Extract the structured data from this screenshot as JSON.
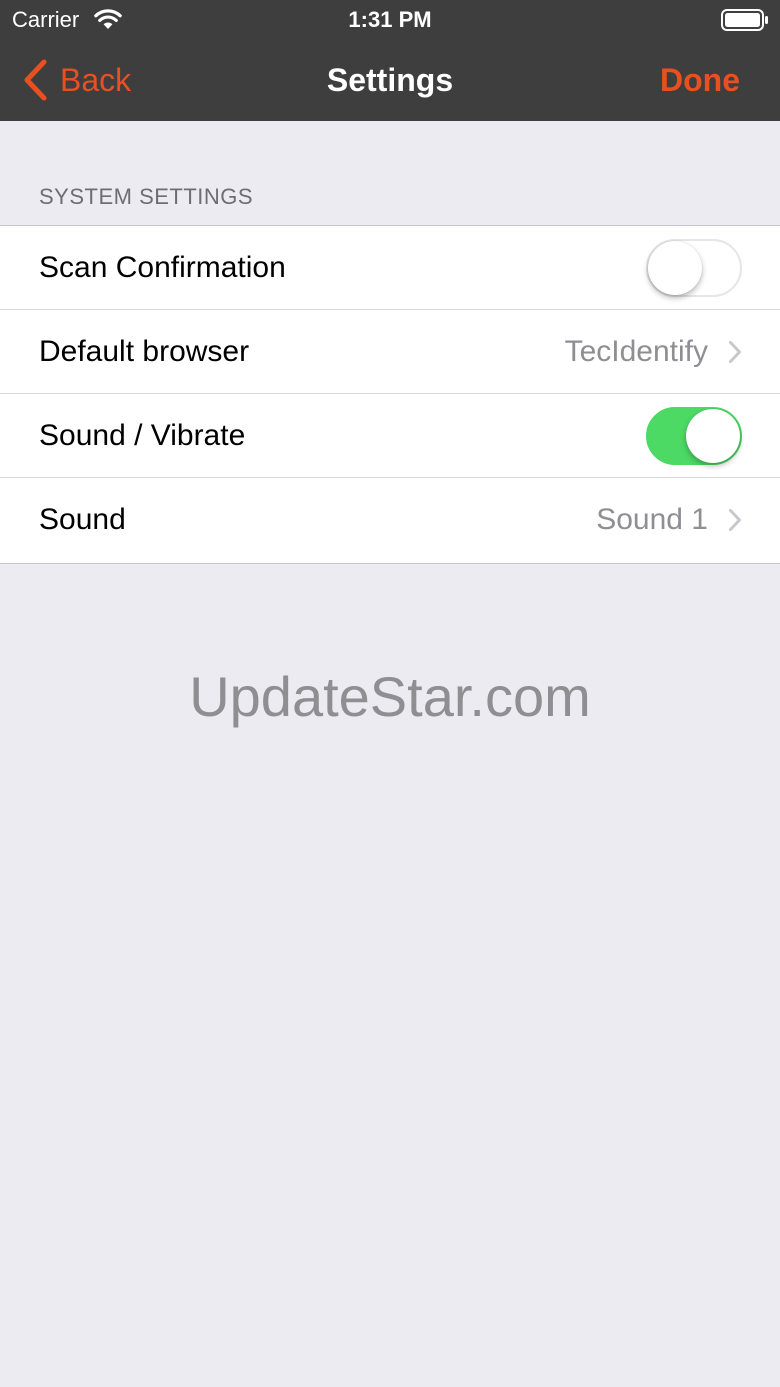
{
  "status_bar": {
    "carrier": "Carrier",
    "time": "1:31 PM",
    "wifi_icon": "wifi-icon",
    "battery_icon": "battery-icon"
  },
  "nav": {
    "back_label": "Back",
    "title": "Settings",
    "done_label": "Done",
    "accent_color": "#e8511f",
    "background_color": "#3e3e3e"
  },
  "section": {
    "header": "SYSTEM SETTINGS",
    "rows": [
      {
        "label": "Scan Confirmation",
        "type": "toggle",
        "on": false
      },
      {
        "label": "Default browser",
        "type": "disclosure",
        "value": "TecIdentify"
      },
      {
        "label": "Sound / Vibrate",
        "type": "toggle",
        "on": true
      },
      {
        "label": "Sound",
        "type": "disclosure",
        "value": "Sound 1"
      }
    ]
  },
  "toggle_on_color": "#4cd964",
  "watermark": "UpdateStar.com"
}
